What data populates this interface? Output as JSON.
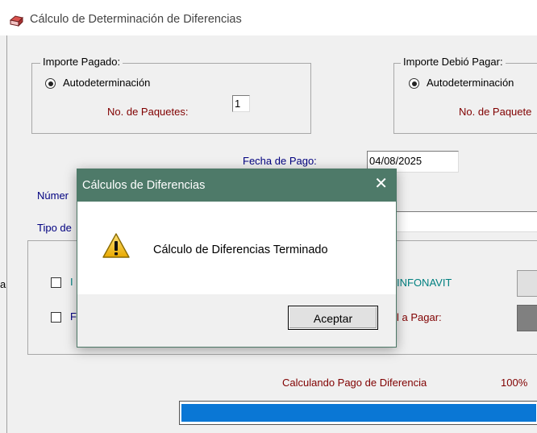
{
  "window": {
    "title": "Cálculo de Determinación de Diferencias"
  },
  "importe_pagado": {
    "legend": "Importe Pagado:",
    "radio_label": "Autodeterminación",
    "paquetes_label": "No. de Paquetes:",
    "paquetes_value": "1"
  },
  "importe_debio": {
    "legend": "Importe Debió Pagar:",
    "radio_label": "Autodeterminación",
    "paquetes_label": "No. de Paquete"
  },
  "fecha_pago": {
    "label": "Fecha de Pago:",
    "value": "04/08/2025"
  },
  "partial_labels": {
    "numero": "Númer",
    "tipo": "Tipo de",
    "left_edge": "a",
    "checkbox1_letter": "I",
    "checkbox2_letter": "F",
    "infonavit": "INFONAVIT",
    "total_pagar": "l a Pagar:"
  },
  "progress": {
    "label": "Calculando Pago de Diferencia",
    "percent_text": "100%",
    "percent": 100
  },
  "dialog": {
    "title": "Cálculos de Diferencias",
    "close_glyph": "✕",
    "message": "Cálculo de Diferencias Terminado",
    "ok_label": "Aceptar",
    "icon": "warning-icon"
  },
  "colors": {
    "dialog_titlebar": "#4e7a69",
    "progress_fill": "#0a77d5",
    "maroon_label": "#800000",
    "navy_label": "#000080",
    "teal_label": "#008080"
  }
}
